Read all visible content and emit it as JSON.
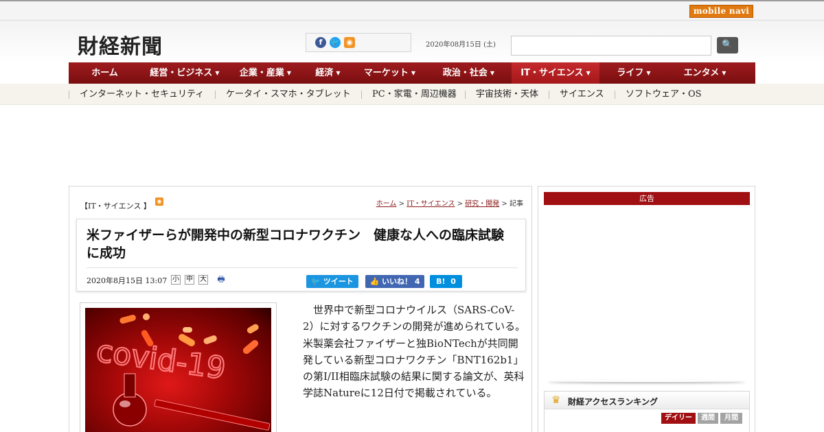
{
  "topbar": {
    "mobilenavi_label": "mobile navi"
  },
  "header": {
    "logo": "財経新聞",
    "date": "2020年08月15日 (土)",
    "search": {
      "value": "",
      "button_icon": "search-icon"
    },
    "social": {
      "facebook": "f",
      "twitter": "t",
      "rss": "rss"
    }
  },
  "nav": {
    "items": [
      {
        "label": "ホーム",
        "caret": ""
      },
      {
        "label": "経営・ビジネス",
        "caret": "▼"
      },
      {
        "label": "企業・産業",
        "caret": "▼"
      },
      {
        "label": "経済",
        "caret": "▼"
      },
      {
        "label": "マーケット",
        "caret": "▼"
      },
      {
        "label": "政治・社会",
        "caret": "▼"
      },
      {
        "label": "IT・サイエンス",
        "caret": "▼"
      },
      {
        "label": "ライフ",
        "caret": "▼"
      },
      {
        "label": "エンタメ",
        "caret": "▼"
      }
    ],
    "active_index": 6
  },
  "subnav": {
    "items": [
      "インターネット・セキュリティ",
      "ケータイ・スマホ・タブレット",
      "PC・家電・周辺機器",
      "宇宙技術・天体",
      "サイエンス",
      "ソフトウェア・OS"
    ]
  },
  "article": {
    "category": "【IT・サイエンス 】",
    "breadcrumb": {
      "home": "ホーム",
      "sep": " > ",
      "section": "IT・サイエンス",
      "subsection": "研究・開発",
      "current": "記事"
    },
    "title": "米ファイザーらが開発中の新型コロナワクチン　健康な人への臨床試験に成功",
    "datetime": "2020年8月15日 13:07",
    "font_sizes": [
      "小",
      "中",
      "大"
    ],
    "share": {
      "tweet": "ツイート",
      "like": "いいね！",
      "like_count": "4",
      "hatena": "B!",
      "hatena_count": "0"
    },
    "body": "世界中で新型コロナウイルス（SARS-CoV-2）に対するワクチンの開発が進められている。米製薬会社ファイザーと独BioNTechが共同開発している新型コロナワクチン「BNT162b1」の第I/II相臨床試験の結果に関する論文が、英科学誌Natureに12日付で掲載されている。",
    "image_text": "covid-19"
  },
  "sidebar": {
    "ad_label": "広告",
    "ranking": {
      "title": "財経アクセスランキング",
      "tabs": [
        "デイリー",
        "週間",
        "月間"
      ]
    }
  },
  "colors": {
    "brand_red": "#9e1b1e",
    "active_red": "#c42a2d",
    "mobile_orange": "#e07a10"
  }
}
